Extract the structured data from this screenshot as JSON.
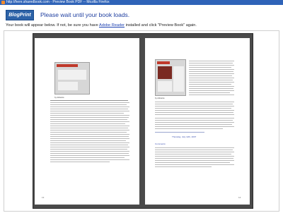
{
  "window": {
    "title": "http://here.sharedbook.com - Preview Book PDF -- Mozilla Firefox"
  },
  "header": {
    "logo_text": "BlogPrint",
    "headline": "Please wait until your book loads.",
    "subline_prefix": "Your book will appear below. If not, be sure you have ",
    "subline_link": "Adobe Reader",
    "subline_suffix": " installed and click \"Preview Book\" again."
  },
  "book": {
    "left_page": {
      "image_caption": "by Adrastos",
      "page_number": "13"
    },
    "right_page": {
      "image_caption": "by Adrastos",
      "page_number": "14",
      "post_date": "Thursday, July 12th, 2007",
      "section_label": "Comments:"
    }
  },
  "colors": {
    "titlebar": "#2f63b8",
    "headline": "#1f3fa0",
    "logo_bg": "#2d63a8",
    "viewer_bg": "#4a4a4a"
  }
}
